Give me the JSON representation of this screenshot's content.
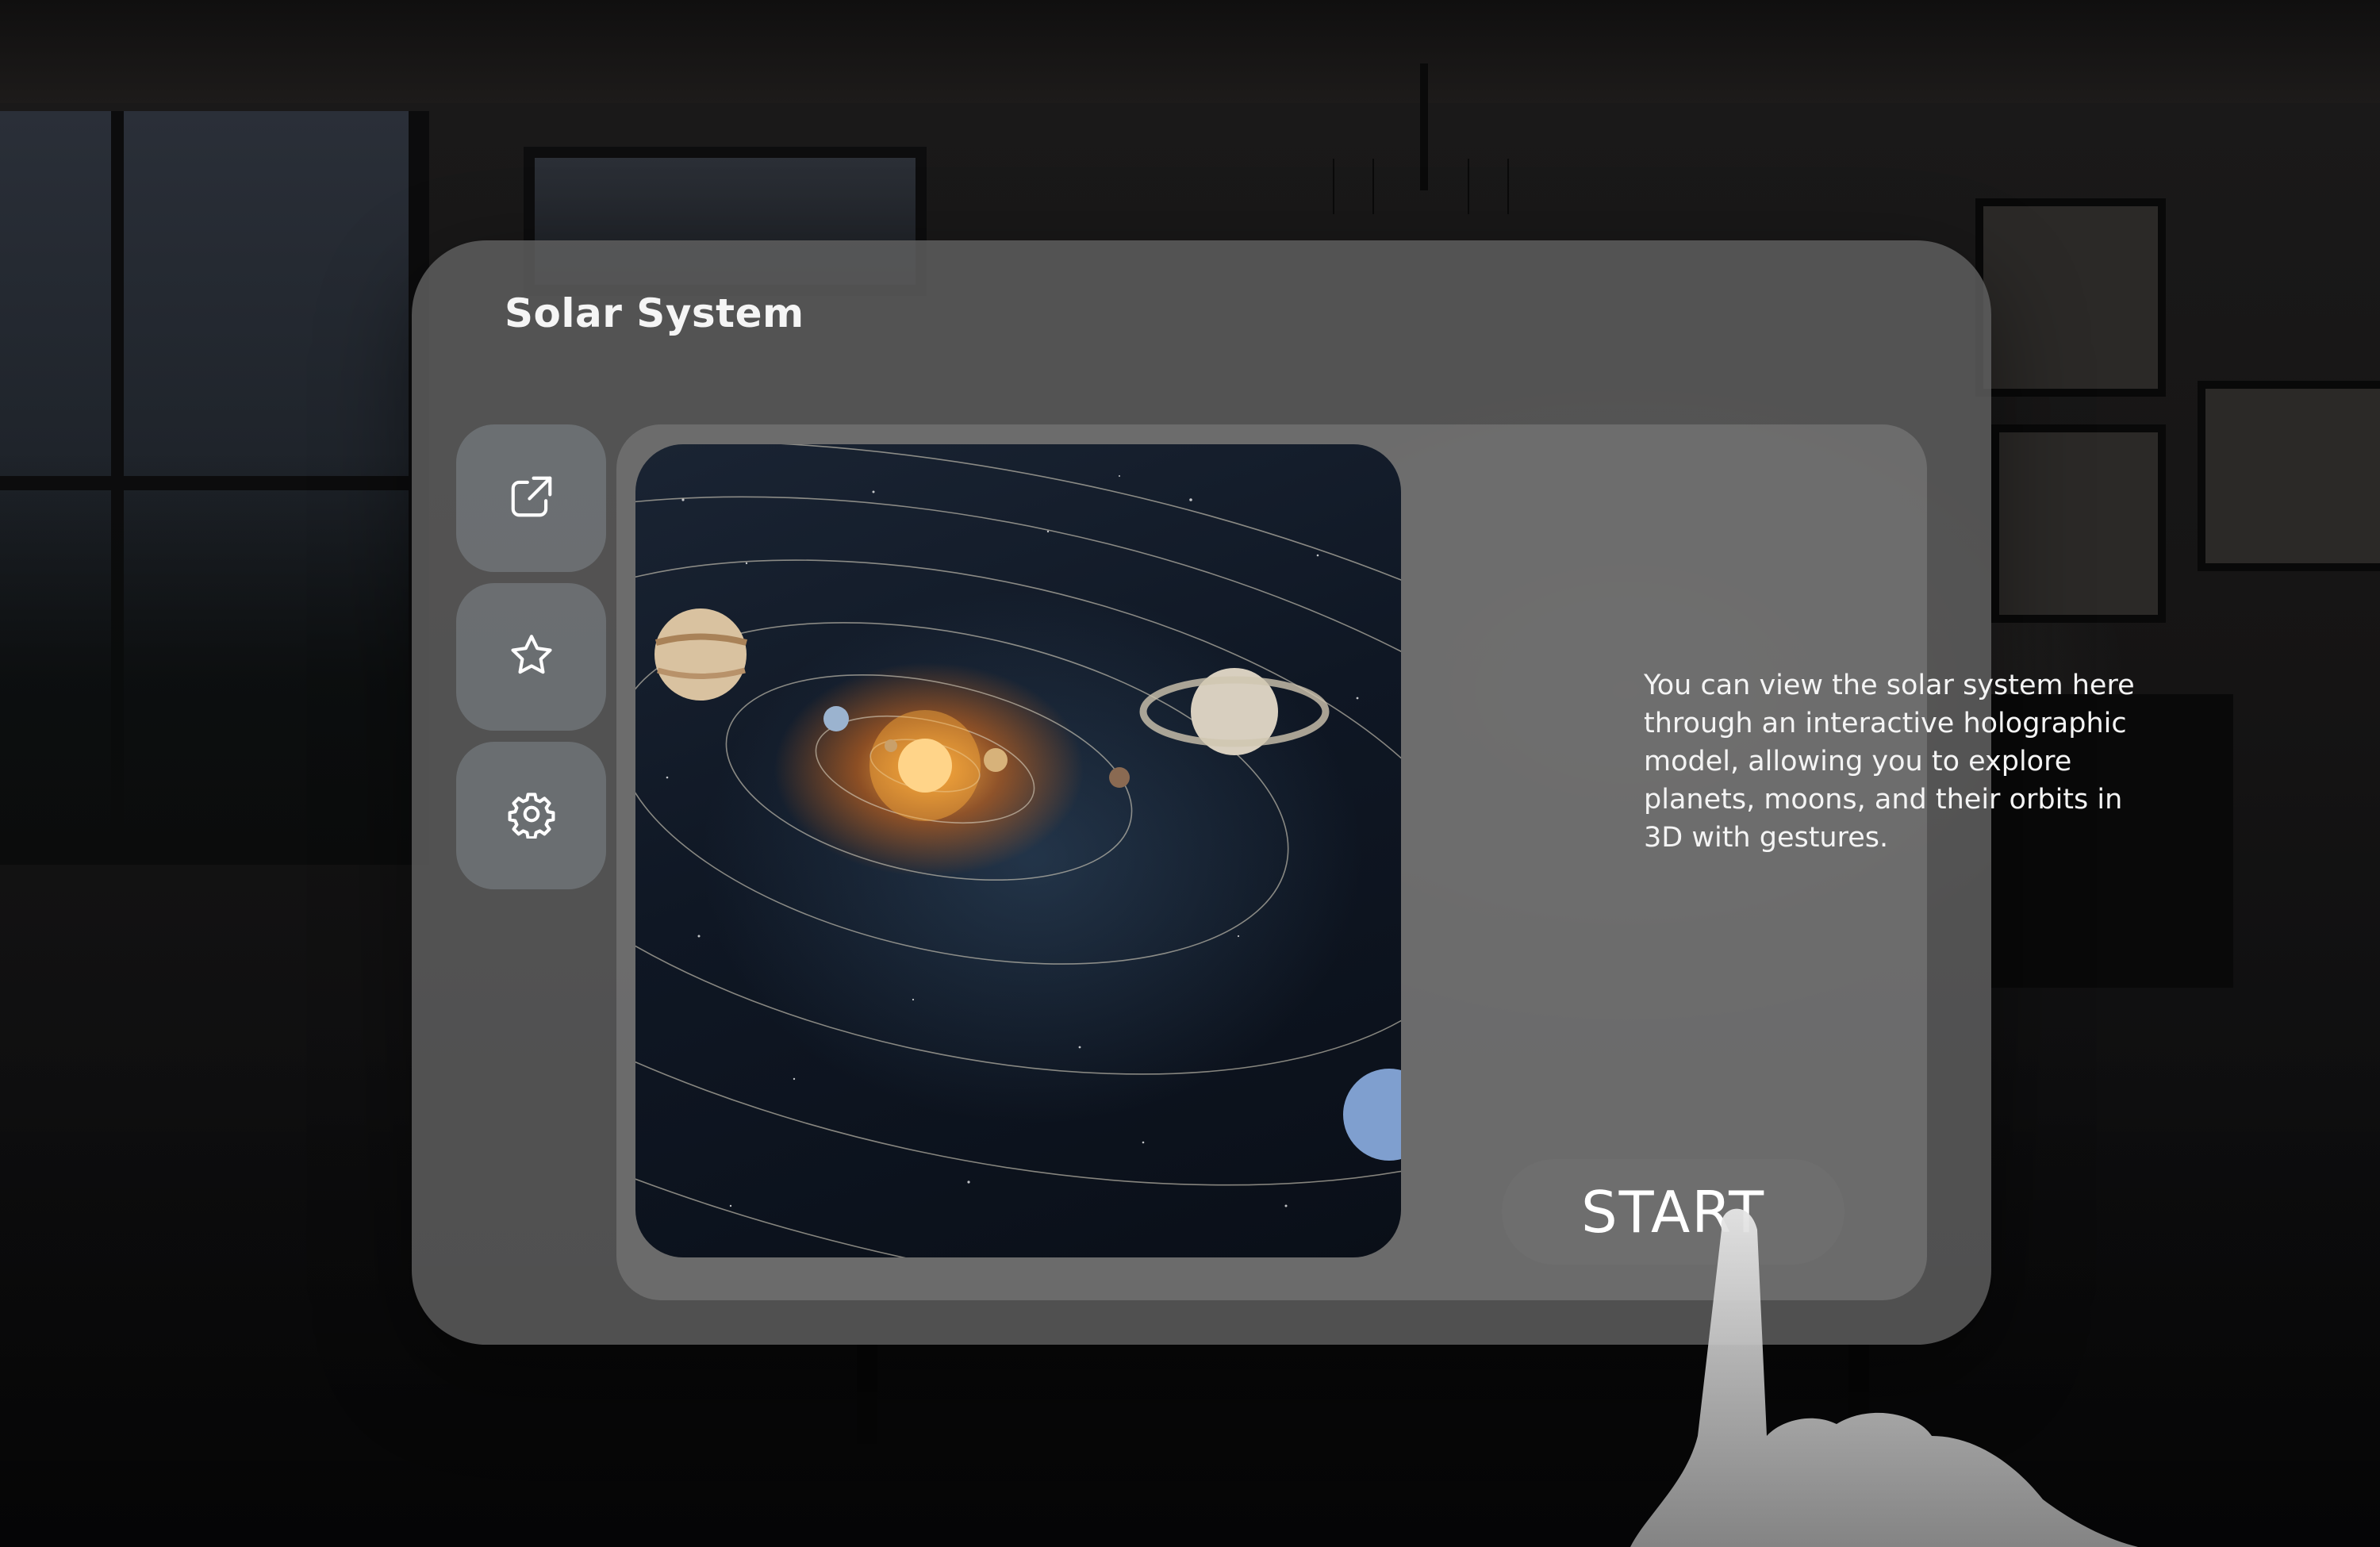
{
  "window": {
    "title": "Solar System"
  },
  "sidebar": {
    "items": [
      {
        "icon": "share-icon",
        "label": ""
      },
      {
        "icon": "star-icon",
        "label": ""
      },
      {
        "icon": "settings-gear-icon",
        "label": ""
      }
    ]
  },
  "main": {
    "hero_image": "solar-system-illustration",
    "description": "You can view the solar system here through an interactive holographic model, allowing you to explore planets, moons, and their orbits in 3D with gestures.",
    "start_label": "START"
  },
  "colors": {
    "panel": "#606060",
    "button": "#6e6e6e",
    "text": "#f5f5f5",
    "sun": "#ffb03c"
  }
}
